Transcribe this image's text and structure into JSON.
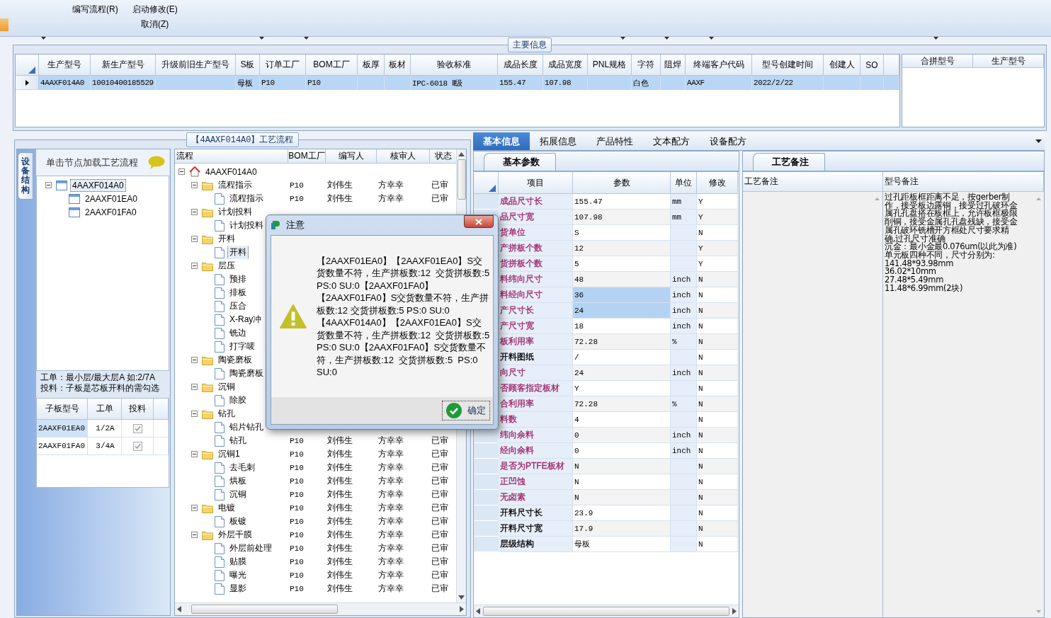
{
  "toolbar": {
    "buttons": [
      {
        "label": "编写流程(R)"
      },
      {
        "label": "启动修改(E)"
      },
      {
        "label": "取消(Z)"
      }
    ]
  },
  "main_info": {
    "title": "主要信息",
    "row_selected": true,
    "columns": [
      {
        "label": "生产型号",
        "value": "4AAXF014A0"
      },
      {
        "label": "新生产型号",
        "value": "10010400185529"
      },
      {
        "label": "升级前旧生产型号"
      },
      {
        "label": "S板",
        "value": "母板"
      },
      {
        "label": "订单工厂",
        "value": "P10"
      },
      {
        "label": "BOM工厂",
        "value": "P10"
      },
      {
        "label": "板厚"
      },
      {
        "label": "板材"
      },
      {
        "label": "验收标准",
        "value": "IPC-6018 Ⅱ级"
      },
      {
        "label": "成品长度",
        "value": "155.47"
      },
      {
        "label": "成品宽度",
        "value": "107.98"
      },
      {
        "label": "PNL规格"
      },
      {
        "label": "字符",
        "value": "白色"
      },
      {
        "label": "阻焊"
      },
      {
        "label": "终端客户代码",
        "value": "AAXF"
      },
      {
        "label": "型号创建时间",
        "value": "2022/2/22"
      },
      {
        "label": "创建人"
      },
      {
        "label": "SO"
      }
    ],
    "side_columns": [
      "合拼型号",
      "生产型号"
    ]
  },
  "process_panel": {
    "title": "【4AAXF014A0】工艺流程",
    "side_tab": "设备结构",
    "hint": "单击节点加载工艺流程",
    "structure_tree": {
      "label": "4AAXF014A0",
      "expanded": true,
      "selected": true,
      "children": [
        {
          "label": "2AAXF01EA0",
          "selected": false
        },
        {
          "label": "2AAXF01FA0",
          "selected": false
        }
      ]
    },
    "notes": [
      "工单：最小层/最大层A 如:2/7A",
      "投料：子板是芯板开料的需勾选"
    ],
    "sub_boards": {
      "columns": [
        "子板型号",
        "工单",
        "投料"
      ],
      "rows": [
        {
          "model": "2AAXF01EA0",
          "order": "1/2A",
          "checked": true,
          "selected": true
        },
        {
          "model": "2AAXF01FA0",
          "order": "3/4A",
          "checked": true,
          "selected": false
        }
      ]
    },
    "flow": {
      "columns": [
        "流程",
        "BOM工厂",
        "编写人",
        "核审人",
        "状态"
      ],
      "root": {
        "label": "4AAXF014A0",
        "expanded": true,
        "selected": false,
        "children": [
          {
            "label": "流程指示",
            "expanded": true,
            "selected": false,
            "bom": "P10",
            "writer": "刘伟生",
            "reviewer": "方幸幸",
            "status": "已审",
            "children": [
              {
                "label": "流程指示",
                "selected": false,
                "bom": "P10",
                "writer": "刘伟生",
                "reviewer": "方幸幸",
                "status": "已审"
              }
            ]
          },
          {
            "label": "计划投料",
            "expanded": true,
            "selected": false,
            "children": [
              {
                "label": "计划投料",
                "selected": false
              }
            ]
          },
          {
            "label": "开料",
            "expanded": true,
            "selected": false,
            "children": [
              {
                "label": "开料",
                "selected": true
              }
            ]
          },
          {
            "label": "层压",
            "expanded": true,
            "selected": false,
            "children": [
              {
                "label": "预排",
                "selected": false
              },
              {
                "label": "排板",
                "selected": false
              },
              {
                "label": "压合",
                "selected": false
              },
              {
                "label": "X-Ray冲",
                "selected": false
              },
              {
                "label": "铣边",
                "selected": false
              },
              {
                "label": "打字唛",
                "selected": false
              }
            ]
          },
          {
            "label": "陶瓷磨板",
            "expanded": true,
            "selected": false,
            "children": [
              {
                "label": "陶瓷磨板",
                "selected": false
              }
            ]
          },
          {
            "label": "沉铜",
            "expanded": true,
            "selected": false,
            "children": [
              {
                "label": "除胶",
                "selected": false
              }
            ]
          },
          {
            "label": "钻孔",
            "expanded": true,
            "selected": false,
            "children": [
              {
                "label": "铝片钻孔",
                "selected": false
              },
              {
                "label": "钻孔",
                "selected": false,
                "bom": "P10",
                "writer": "刘伟生",
                "reviewer": "方幸幸",
                "status": "已审"
              }
            ]
          },
          {
            "label": "沉铜1",
            "expanded": true,
            "selected": false,
            "bom": "P10",
            "writer": "刘伟生",
            "reviewer": "方幸幸",
            "status": "已审",
            "children": [
              {
                "label": "去毛刺",
                "selected": false,
                "bom": "P10",
                "writer": "刘伟生",
                "reviewer": "方幸幸",
                "status": "已审"
              },
              {
                "label": "烘板",
                "selected": false,
                "bom": "P10",
                "writer": "刘伟生",
                "reviewer": "方幸幸",
                "status": "已审"
              },
              {
                "label": "沉铜",
                "selected": false,
                "bom": "P10",
                "writer": "刘伟生",
                "reviewer": "方幸幸",
                "status": "已审"
              }
            ]
          },
          {
            "label": "电镀",
            "expanded": true,
            "selected": false,
            "bom": "P10",
            "writer": "刘伟生",
            "reviewer": "方幸幸",
            "status": "已审",
            "children": [
              {
                "label": "板镀",
                "selected": false,
                "bom": "P10",
                "writer": "刘伟生",
                "reviewer": "方幸幸",
                "status": "已审"
              }
            ]
          },
          {
            "label": "外层干膜",
            "expanded": true,
            "selected": false,
            "bom": "P10",
            "writer": "刘伟生",
            "reviewer": "方幸幸",
            "status": "已审",
            "children": [
              {
                "label": "外层前处理",
                "selected": false,
                "bom": "P10",
                "writer": "刘伟生",
                "reviewer": "方幸幸",
                "status": "已审"
              },
              {
                "label": "贴膜",
                "selected": false,
                "bom": "P10",
                "writer": "刘伟生",
                "reviewer": "方幸幸",
                "status": "已审"
              },
              {
                "label": "曝光",
                "selected": false,
                "bom": "P10",
                "writer": "刘伟生",
                "reviewer": "方幸幸",
                "status": "已审"
              },
              {
                "label": "显影",
                "selected": false,
                "bom": "P10",
                "writer": "刘伟生",
                "reviewer": "方幸幸",
                "status": "已审"
              }
            ]
          }
        ]
      }
    }
  },
  "detail_tabs": [
    {
      "label": "基本信息",
      "selected": true
    },
    {
      "label": "拓展信息",
      "selected": false
    },
    {
      "label": "产品特性",
      "selected": false
    },
    {
      "label": "文本配方",
      "selected": false
    },
    {
      "label": "设备配方",
      "selected": false
    }
  ],
  "basic_params": {
    "tab": "基本参数",
    "columns": [
      "项目",
      "参数",
      "单位",
      "修改"
    ],
    "rows": [
      {
        "item": "成品尺寸长",
        "value": "155.47",
        "unit": "mm",
        "modified": "Y",
        "color": "#a02a6e",
        "selected": false
      },
      {
        "item": "品尺寸宽",
        "value": "107.98",
        "unit": "mm",
        "modified": "Y",
        "color": "#a02a6e",
        "selected": false
      },
      {
        "item": "货单位",
        "value": "S",
        "modified": "N",
        "color": "#a02a6e",
        "selected": false
      },
      {
        "item": "产拼板个数",
        "value": "12",
        "modified": "Y",
        "color": "#a02a6e",
        "selected": false
      },
      {
        "item": "货拼板个数",
        "value": "5",
        "modified": "Y",
        "color": "#a02a6e",
        "selected": false
      },
      {
        "item": "料纬向尺寸",
        "value": "48",
        "unit": "inch",
        "modified": "N",
        "color": "#a02a6e",
        "selected": false
      },
      {
        "item": "料经向尺寸",
        "value": "36",
        "unit": "inch",
        "modified": "N",
        "color": "#a02a6e",
        "selected": true
      },
      {
        "item": "产尺寸长",
        "value": "24",
        "unit": "inch",
        "modified": "N",
        "color": "#a02a6e",
        "selected": true
      },
      {
        "item": "产尺寸宽",
        "value": "18",
        "unit": "inch",
        "modified": "N",
        "color": "#a02a6e",
        "selected": false
      },
      {
        "item": "板利用率",
        "value": "72.28",
        "unit": "%",
        "modified": "N",
        "color": "#a02a6e",
        "selected": false
      },
      {
        "item": "开料图纸",
        "value": "/",
        "modified": "N",
        "color": "#000000",
        "selected": false
      },
      {
        "item": "向尺寸",
        "value": "24",
        "unit": "inch",
        "modified": "N",
        "color": "#a02a6e",
        "selected": false
      },
      {
        "item": "否顾客指定板材",
        "value": "Y",
        "modified": "N",
        "color": "#a02a6e",
        "selected": false
      },
      {
        "item": "合利用率",
        "value": "72.28",
        "unit": "%",
        "modified": "N",
        "color": "#a02a6e",
        "selected": false
      },
      {
        "item": "料数",
        "value": "4",
        "modified": "N",
        "color": "#a02a6e",
        "selected": false
      },
      {
        "item": "纬向余料",
        "value": "0",
        "unit": "inch",
        "modified": "N",
        "color": "#a02a6e",
        "selected": false
      },
      {
        "item": "经向余料",
        "value": "0",
        "unit": "inch",
        "modified": "N",
        "color": "#a02a6e",
        "selected": false
      },
      {
        "item": "是否为PTFE板材",
        "value": "N",
        "modified": "N",
        "color": "#a02a6e",
        "selected": false
      },
      {
        "item": "正凹蚀",
        "value": "N",
        "modified": "N",
        "color": "#a02a6e",
        "selected": false
      },
      {
        "item": "无卤素",
        "value": "N",
        "modified": "N",
        "color": "#a02a6e",
        "selected": false
      },
      {
        "item": "开料尺寸长",
        "value": "23.9",
        "modified": "N",
        "color": "#000000",
        "selected": false
      },
      {
        "item": "开料尺寸宽",
        "value": "17.9",
        "modified": "N",
        "color": "#000000",
        "selected": false
      },
      {
        "item": "层级结构",
        "value": "母板",
        "modified": "N",
        "color": "#000000",
        "selected": false
      }
    ]
  },
  "remarks": {
    "tab": "工艺备注",
    "columns": [
      "工艺备注",
      "型号备注"
    ],
    "model_remark": [
      "过孔距板框距离不足，按gerber制作，接受板边露铜，接受过孔破环金属孔孔盘搭在板框上，允许板框极限削铜，接受金属孔孔盘残缺，接受金属孔破环铣槽开方框处尺寸要求精确,过孔尺寸准确",
      "沉金：最小金最0.076um(以此为准)",
      "单元板四种不同，尺寸分别为:",
      "141.48*93.98mm",
      "36.02*10mm",
      "27.48*5.49mm",
      "11.48*6.99mm(2块)"
    ]
  },
  "dialog": {
    "title": "注意",
    "message": "【2AAXF01EA0】【2AAXF01EA0】S交货数量不符，生产拼板数:12  交货拼板数:5 PS:0 SU:0【2AAXF01FA0】【2AAXF01FA0】S交货数量不符，生产拼板数:12 交货拼板数:5 PS:0 SU:0【4AAXF014A0】【2AAXF01EA0】S交货数量不符，生产拼板数:12  交货拼板数:5  PS:0 SU:0【2AAXF01FA0】S交货数量不符，生产拼板数:12  交货拼板数:5  PS:0 SU:0",
    "ok": "确定"
  }
}
